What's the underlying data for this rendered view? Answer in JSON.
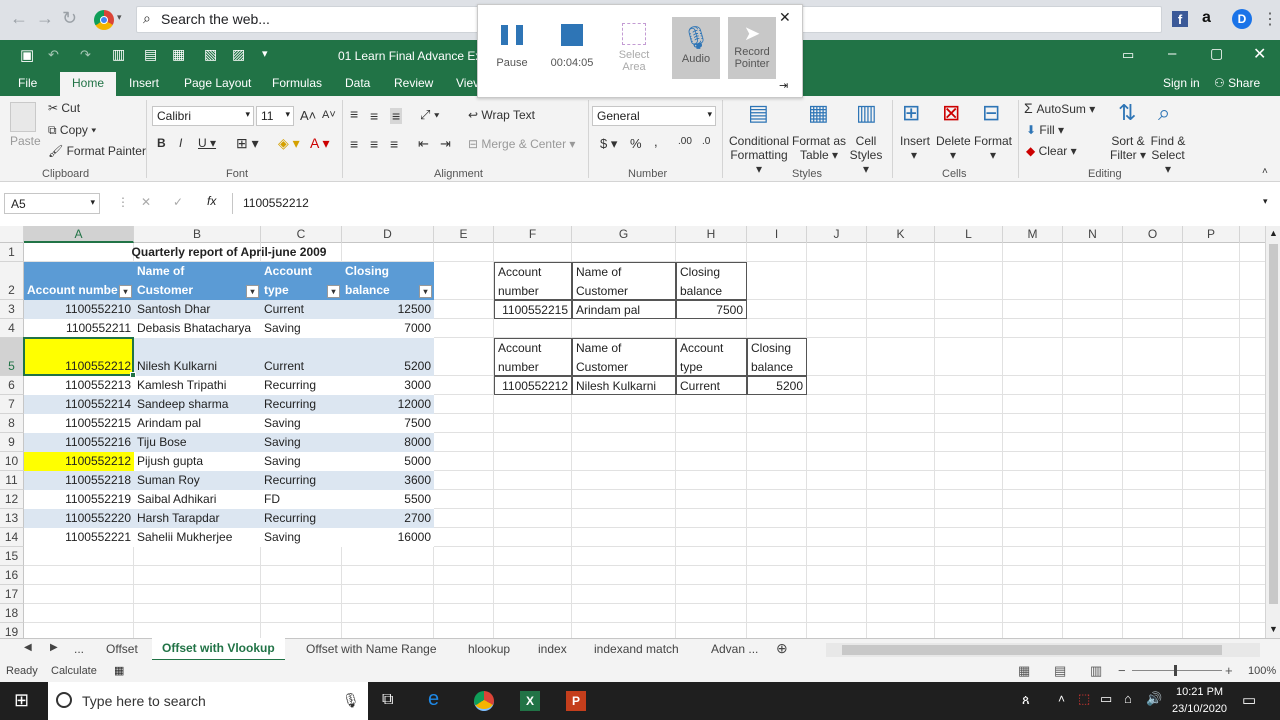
{
  "browser": {
    "search_placeholder": "Search the web..."
  },
  "excel": {
    "title": "01 Learn Final Advance Exce",
    "sign_in": "Sign in",
    "share": "Share",
    "tabs": [
      "File",
      "Home",
      "Insert",
      "Page Layout",
      "Formulas",
      "Data",
      "Review",
      "Viev"
    ],
    "ribbon": {
      "cut": "Cut",
      "copy": "Copy",
      "format_painter": "Format Painter",
      "paste": "Paste",
      "font_name": "Calibri",
      "font_size": "11",
      "wrap_text": "Wrap Text",
      "merge_center": "Merge & Center",
      "number_format": "General",
      "conditional_formatting": [
        "Conditional",
        "Formatting"
      ],
      "format_as_table": [
        "Format as",
        "Table"
      ],
      "cell_styles": [
        "Cell",
        "Styles"
      ],
      "insert": "Insert",
      "delete": "Delete",
      "format": "Format",
      "autosum": "AutoSum",
      "fill": "Fill",
      "clear": "Clear",
      "sort_filter": [
        "Sort &",
        "Filter"
      ],
      "find_select": [
        "Find &",
        "Select"
      ],
      "groups": {
        "clipboard": "Clipboard",
        "font": "Font",
        "alignment": "Alignment",
        "number": "Number",
        "styles": "Styles",
        "cells": "Cells",
        "editing": "Editing"
      }
    },
    "name_box": "A5",
    "formula": "1100552212",
    "columns": [
      "A",
      "B",
      "C",
      "D",
      "E",
      "F",
      "G",
      "H",
      "I",
      "J",
      "K",
      "L",
      "M",
      "N",
      "O",
      "P"
    ],
    "rows": [
      "1",
      "2",
      "3",
      "4",
      "5",
      "6",
      "7",
      "8",
      "9",
      "10",
      "11",
      "12",
      "13",
      "14",
      "15",
      "16",
      "17",
      "18",
      "19"
    ],
    "title_cell": "Quarterly report of April-june 2009",
    "headers": [
      [
        "Account numbe"
      ],
      [
        "Name of",
        "Customer"
      ],
      [
        "Account",
        "type"
      ],
      [
        "Closing",
        "balance"
      ]
    ],
    "table": [
      [
        "1100552210",
        "Santosh Dhar",
        "Current",
        "12500"
      ],
      [
        "1100552211",
        "Debasis Bhatacharya",
        "Saving",
        "7000"
      ],
      [
        "1100552212",
        "Nilesh Kulkarni",
        "Current",
        "5200"
      ],
      [
        "1100552213",
        "Kamlesh Tripathi",
        "Recurring",
        "3000"
      ],
      [
        "1100552214",
        "Sandeep sharma",
        "Recurring",
        "12000"
      ],
      [
        "1100552215",
        "Arindam pal",
        "Saving",
        "7500"
      ],
      [
        "1100552216",
        "Tiju Bose",
        "Saving",
        "8000"
      ],
      [
        "1100552212",
        "Pijush gupta",
        "Saving",
        "5000"
      ],
      [
        "1100552218",
        "Suman Roy",
        "Recurring",
        "3600"
      ],
      [
        "1100552219",
        "Saibal Adhikari",
        "FD",
        "5500"
      ],
      [
        "1100552220",
        "Harsh Tarapdar",
        "Recurring",
        "2700"
      ],
      [
        "1100552221",
        "Sahelii Mukherjee",
        "Saving",
        "16000"
      ]
    ],
    "lookup1": {
      "headers": [
        [
          "Account",
          "number"
        ],
        [
          "Name of",
          "Customer"
        ],
        [
          "Closing",
          "balance"
        ]
      ],
      "row": [
        "1100552215",
        "Arindam pal",
        "7500"
      ]
    },
    "lookup2": {
      "headers": [
        [
          "Account",
          "number"
        ],
        [
          "Name of",
          "Customer"
        ],
        [
          "Account",
          "type"
        ],
        [
          "Closing",
          "balance"
        ]
      ],
      "row": [
        "1100552212",
        "Nilesh Kulkarni",
        "Current",
        "5200"
      ]
    },
    "sheet_tabs": [
      "...",
      "Offset",
      "Offset with Vlookup",
      "Offset with Name Range",
      "hlookup",
      "index",
      "indexand match",
      "Advan ..."
    ],
    "status": {
      "ready": "Ready",
      "calculate": "Calculate",
      "zoom": "100%"
    },
    "highlight_color": "#ffff00",
    "header_fill": "#5b9bd5",
    "band_fill": "#dce6f1",
    "excel_green": "#217346"
  },
  "recorder": {
    "pause": "Pause",
    "time": "00:04:05",
    "select": [
      "Select",
      "Area"
    ],
    "audio": "Audio",
    "record": [
      "Record",
      "Pointer"
    ]
  },
  "taskbar": {
    "search": "Type here to search",
    "time": "10:21 PM",
    "date": "23/10/2020"
  }
}
